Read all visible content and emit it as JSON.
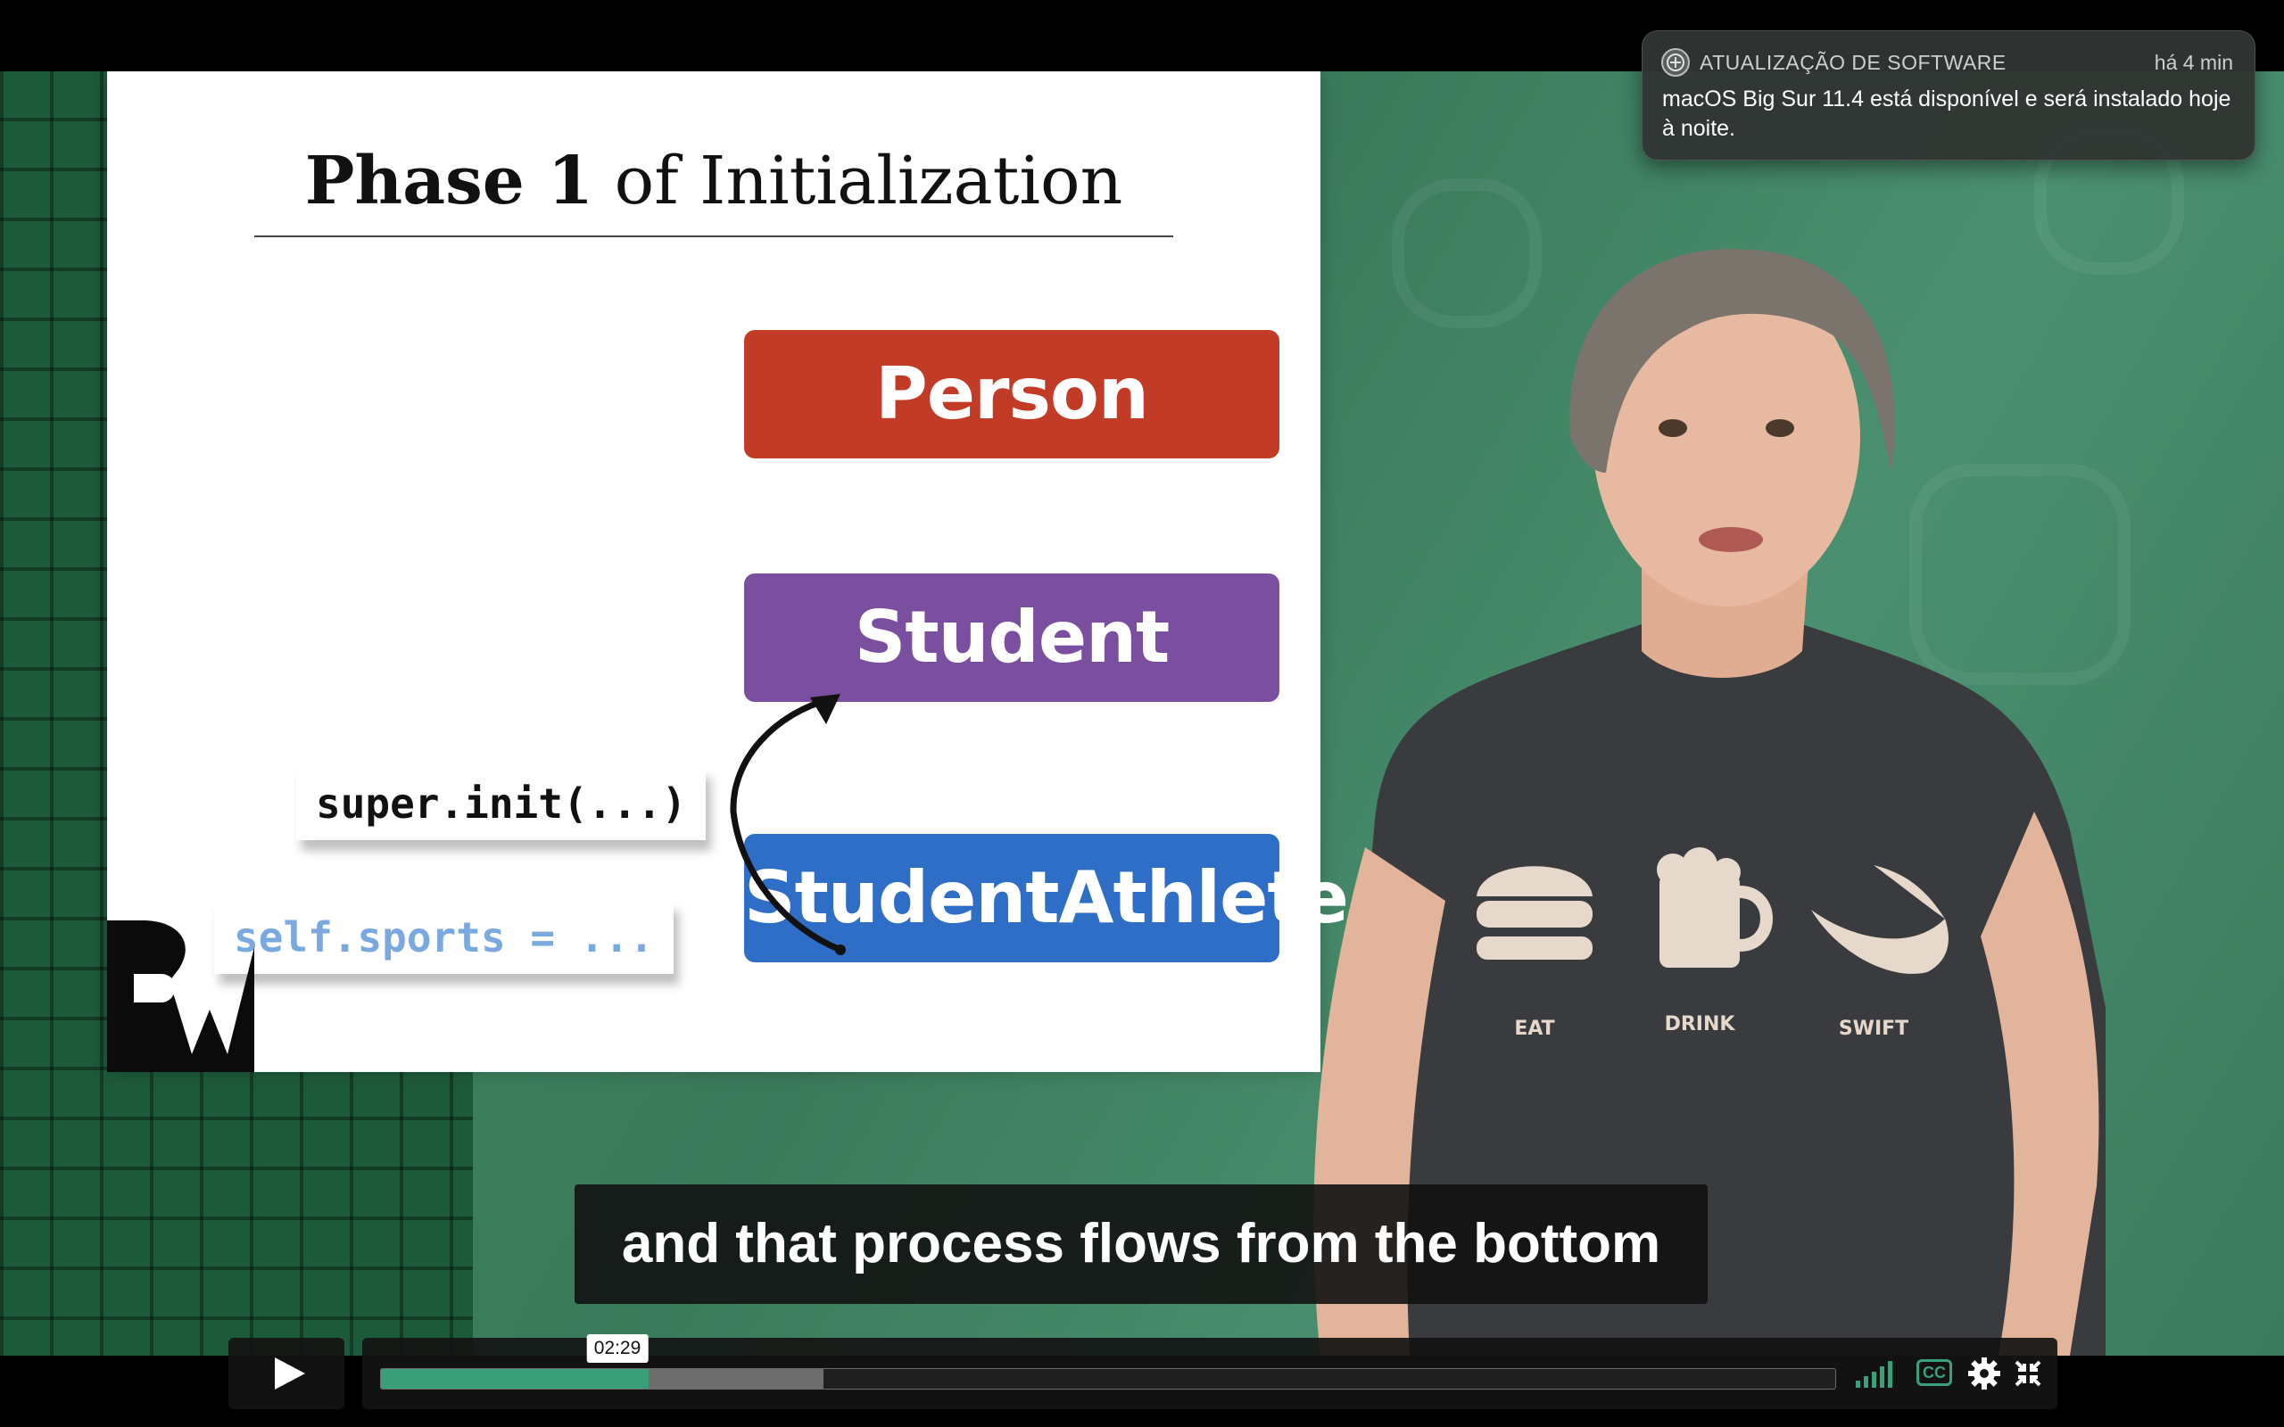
{
  "slide": {
    "title_bold": "Phase 1",
    "title_rest": " of Initialization",
    "classes": [
      "Person",
      "Student",
      "StudentAthlete"
    ],
    "colors": {
      "person": "#c23b26",
      "student": "#7b4fa0",
      "student_athlete": "#2f6ec7"
    },
    "code_super": "super.init(...)",
    "code_self": "self.sports = ...",
    "code_self_color": "#7aa9e0"
  },
  "presenter_shirt": {
    "items": [
      "EAT",
      "DRINK",
      "SWIFT"
    ]
  },
  "subtitle": "and that process flows from the bottom",
  "player": {
    "current_time": "02:29",
    "progress_fraction": 0.184,
    "buffered_fraction": 0.304,
    "played_color": "#3b9f7a",
    "icons": [
      "play-icon",
      "volume-icon",
      "cc-icon",
      "gear-icon",
      "fullscreen-exit-icon"
    ],
    "cc_label": "CC"
  },
  "notification": {
    "app": "ATUALIZAÇÃO DE SOFTWARE",
    "time": "há 4 min",
    "body": "macOS Big Sur 11.4 está disponível e será instalado hoje à noite."
  }
}
